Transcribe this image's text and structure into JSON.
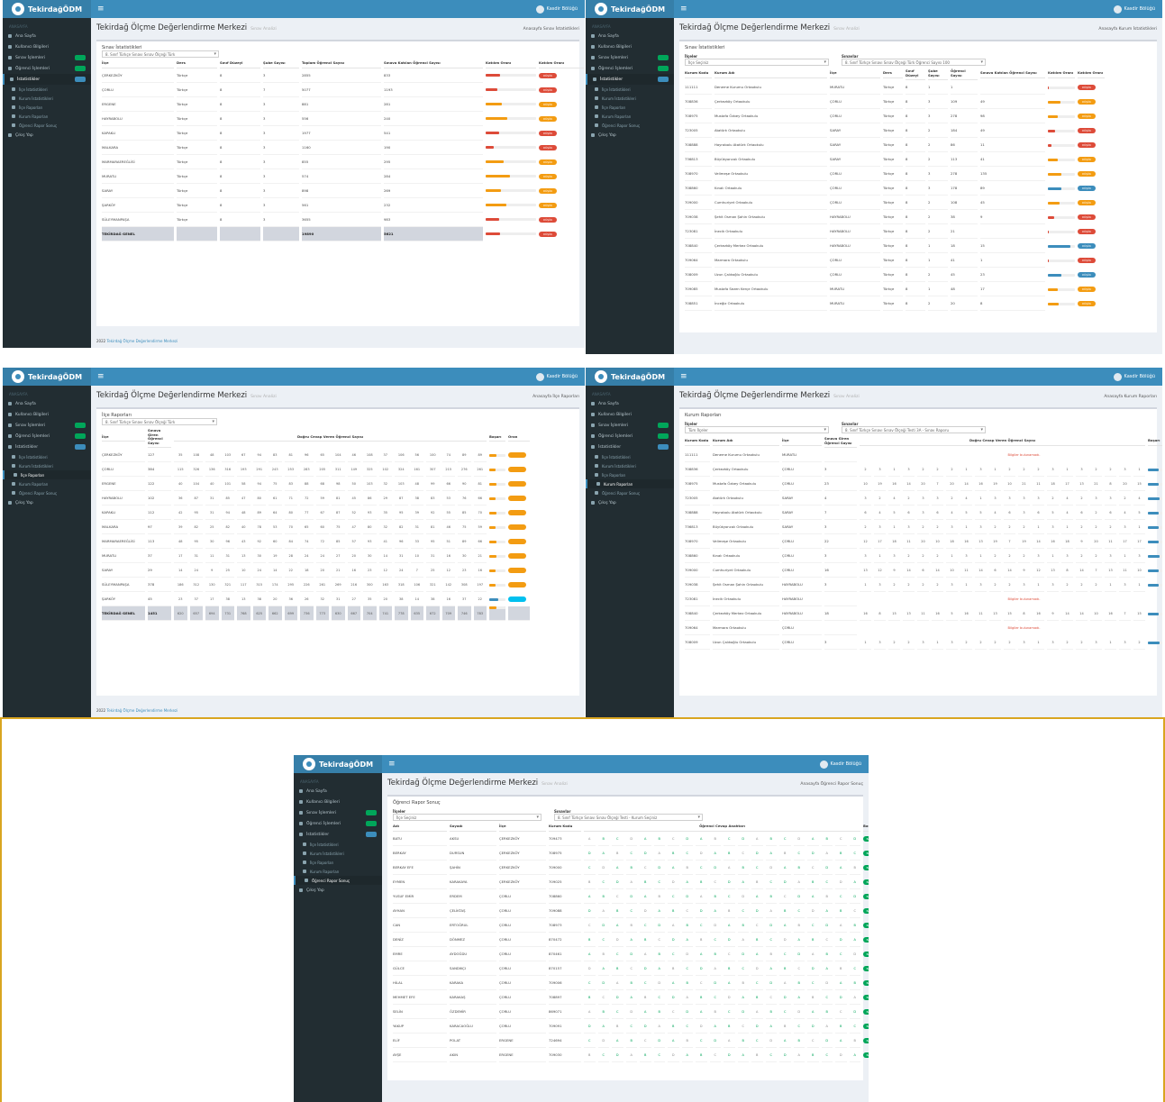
{
  "app": {
    "logo": "TekirdağÖDM",
    "user": "Kasdir Bölüğü",
    "page_title": "Tekirdağ Ölçme Değerlendirme Merkezi",
    "page_subtitle": "Sınav Analizi",
    "footer": "2022",
    "footer_link": "Tekirdağ Ölçme Değerlendirme Merkezi"
  },
  "colors": {
    "brand": "#3c8dbc",
    "sidebar": "#222d32",
    "danger": "#dd4b39",
    "warning": "#f39c12",
    "info": "#00c0ef",
    "success": "#00a65a",
    "primary": "#3c8dbc"
  },
  "sidebar": {
    "header": "ANASAYFA",
    "items": [
      {
        "label": "Ana Sayfa",
        "icon": "home-icon"
      },
      {
        "label": "Kullanıcı Bilgileri",
        "icon": "user-icon"
      },
      {
        "label": "Sınav İşlemleri",
        "icon": "exam-icon"
      },
      {
        "label": "Öğrenci İşlemleri",
        "icon": "student-icon"
      },
      {
        "label": "İstatistikler",
        "icon": "chart-icon"
      },
      {
        "label": "İlçe İstatistikleri",
        "icon": "chart-icon"
      },
      {
        "label": "Kurum İstatistikleri",
        "icon": "chart-icon"
      },
      {
        "label": "İlçe Raporları",
        "icon": "report-icon"
      },
      {
        "label": "Kurum Raporları",
        "icon": "report-icon"
      },
      {
        "label": "Öğrenci Rapor Sonuç",
        "icon": "report-icon"
      },
      {
        "label": "Çıkış Yap",
        "icon": "logout-icon"
      }
    ]
  },
  "screen1": {
    "box_title": "Sınav İstatistikleri",
    "filter": "8. Sınıf Türkçe Sınavı Sınav Ölçeği Türk",
    "crumb": "Anasayfa  Sınav İstatistikleri",
    "headers": [
      "İlçe",
      "Ders",
      "Sınıf Düzeyi",
      "Şube Sayısı",
      "Toplam Öğrenci Sayısı",
      "Sınava Katılan Öğrenci Sayısı",
      "Katılım Oranı",
      "Katılım Oranı"
    ],
    "rows": [
      {
        "ilce": "ÇERKEZKÖY",
        "ders": "Türkçe",
        "sinif": "8",
        "sube": "3",
        "toplam": "2855",
        "katilan": "833",
        "oran": 0.29
      },
      {
        "ilce": "ÇORLU",
        "ders": "Türkçe",
        "sinif": "8",
        "sube": "7",
        "toplam": "5077",
        "katilan": "1193",
        "oran": 0.23
      },
      {
        "ilce": "ERGENE",
        "ders": "Türkçe",
        "sinif": "8",
        "sube": "3",
        "toplam": "881",
        "katilan": "281",
        "oran": 0.32
      },
      {
        "ilce": "HAYRABOLU",
        "ders": "Türkçe",
        "sinif": "8",
        "sube": "3",
        "toplam": "556",
        "katilan": "240",
        "oran": 0.43
      },
      {
        "ilce": "KAPAKLI",
        "ders": "Türkçe",
        "sinif": "8",
        "sube": "3",
        "toplam": "1977",
        "katilan": "541",
        "oran": 0.27
      },
      {
        "ilce": "MALKARA",
        "ders": "Türkçe",
        "sinif": "8",
        "sube": "3",
        "toplam": "1160",
        "katilan": "190",
        "oran": 0.16
      },
      {
        "ilce": "MARMARAEREĞLİSİ",
        "ders": "Türkçe",
        "sinif": "8",
        "sube": "3",
        "toplam": "855",
        "katilan": "295",
        "oran": 0.35
      },
      {
        "ilce": "MURATLI",
        "ders": "Türkçe",
        "sinif": "8",
        "sube": "3",
        "toplam": "574",
        "katilan": "284",
        "oran": 0.49
      },
      {
        "ilce": "SARAY",
        "ders": "Türkçe",
        "sinif": "8",
        "sube": "3",
        "toplam": "898",
        "katilan": "269",
        "oran": 0.3
      },
      {
        "ilce": "ŞARKÖY",
        "ders": "Türkçe",
        "sinif": "8",
        "sube": "3",
        "toplam": "561",
        "katilan": "232",
        "oran": 0.41
      },
      {
        "ilce": "SÜLEYMANPAŞA",
        "ders": "Türkçe",
        "sinif": "8",
        "sube": "3",
        "toplam": "3655",
        "katilan": "983",
        "oran": 0.27
      }
    ],
    "total": {
      "ilce": "TEKİRDAĞ GENEL",
      "toplam": "19890",
      "katilan": "5621",
      "oran": 0.28
    },
    "pill": "DÜŞÜK"
  },
  "screen2": {
    "box_title": "Sınav İstatistikleri",
    "label1": "İlçeler",
    "label2": "Sınavlar",
    "filter1": "İlçe Seçiniz",
    "filter2": "8. Sınıf Türkçe Sınavı Sınav Ölçeği Türk  Öğrenci Sayısı 100",
    "crumb": "Anasayfa  Kurum İstatistikleri",
    "headers": [
      "Kurum Kodu",
      "Kurum Adı",
      "İlçe",
      "Ders",
      "Sınıf Düzeyi",
      "Şube Sayısı",
      "Öğrenci Sayısı",
      "Sınava Katılan Öğrenci Sayısı",
      "Katılım Oranı",
      "Katılım Oranı"
    ],
    "rows": [
      {
        "kod": "111111",
        "ad": "Deneme Kurumu Ortaokulu",
        "ilce": "MURATLI",
        "sube": "1",
        "ogr": "1",
        "kat": "",
        "oran": 0.0
      },
      {
        "kod": "708836",
        "ad": "Çerkezköy Ortaokulu",
        "ilce": "ÇORLU",
        "sube": "3",
        "ogr": "109",
        "kat": "49",
        "oran": 0.45
      },
      {
        "kod": "708975",
        "ad": "Mustafa Özbey Ortaokulu",
        "ilce": "ÇORLU",
        "sube": "3",
        "ogr": "278",
        "kat": "98",
        "oran": 0.35
      },
      {
        "kod": "723005",
        "ad": "Atatürk Ortaokulu",
        "ilce": "SARAY",
        "sube": "2",
        "ogr": "184",
        "kat": "49",
        "oran": 0.27
      },
      {
        "kod": "708888",
        "ad": "Hayrabolu Atatürk Ortaokulu",
        "ilce": "SARAY",
        "sube": "2",
        "ogr": "86",
        "kat": "11",
        "oran": 0.13
      },
      {
        "kod": "736813",
        "ad": "Büyükyoncalı Ortaokulu",
        "ilce": "SARAY",
        "sube": "2",
        "ogr": "113",
        "kat": "41",
        "oran": 0.36
      },
      {
        "kod": "708970",
        "ad": "Velimeşe Ortaokulu",
        "ilce": "ÇORLU",
        "sube": "3",
        "ogr": "278",
        "kat": "135",
        "oran": 0.49
      },
      {
        "kod": "708860",
        "ad": "Kınalı Ortaokulu",
        "ilce": "ÇORLU",
        "sube": "3",
        "ogr": "178",
        "kat": "89",
        "oran": 0.5
      },
      {
        "kod": "709000",
        "ad": "Cumhuriyet Ortaokulu",
        "ilce": "ÇORLU",
        "sube": "2",
        "ogr": "108",
        "kat": "45",
        "oran": 0.42
      },
      {
        "kod": "709038",
        "ad": "Şehit Osman Şahin Ortaokulu",
        "ilce": "HAYRABOLU",
        "sube": "2",
        "ogr": "38",
        "kat": "9",
        "oran": 0.24
      },
      {
        "kod": "723081",
        "ad": "İnecik Ortaokulu",
        "ilce": "HAYRABOLU",
        "sube": "2",
        "ogr": "21",
        "kat": "",
        "oran": 0.0
      },
      {
        "kod": "708840",
        "ad": "Çerkezköy Merkez Ortaokulu",
        "ilce": "HAYRABOLU",
        "sube": "1",
        "ogr": "18",
        "kat": "15",
        "oran": 0.83
      },
      {
        "kod": "709064",
        "ad": "Marmara Ortaokulu",
        "ilce": "ÇORLU",
        "sube": "1",
        "ogr": "41",
        "kat": "1",
        "oran": 0.02
      },
      {
        "kod": "708009",
        "ad": "Uzun Çalıkoğlu Ortaokulu",
        "ilce": "ÇORLU",
        "sube": "2",
        "ogr": "45",
        "kat": "23",
        "oran": 0.51
      },
      {
        "kod": "709085",
        "ad": "Mustafa Sezen Kerçe Ortaokulu",
        "ilce": "MURATLI",
        "sube": "1",
        "ogr": "48",
        "kat": "17",
        "oran": 0.35
      },
      {
        "kod": "708851",
        "ad": "İnceğiz Ortaokulu",
        "ilce": "MURATLI",
        "sube": "2",
        "ogr": "20",
        "kat": "8",
        "oran": 0.4
      }
    ],
    "pill": "DÜŞÜK"
  },
  "screen3": {
    "box_title": "İlçe Raporları",
    "filter": "8. Sınıf Türkçe Sınavı Sınav Ölçeği Türk",
    "crumb": "Anasayfa  İlçe Raporları",
    "group_header": "Doğru Cevap Veren Öğrenci Sayısı",
    "headers_a": [
      "İlçe",
      "Sınava Giren Öğrenci Sayısı"
    ],
    "headers_b": [
      "Başarı",
      "Oran"
    ],
    "q_prefix": "Soru",
    "rows": [
      {
        "ilce": "ÇERKEZKÖY",
        "n": "127",
        "s": 0.42
      },
      {
        "ilce": "ÇORLU",
        "n": "384",
        "s": 0.39
      },
      {
        "ilce": "ERGENE",
        "n": "122",
        "s": 0.45
      },
      {
        "ilce": "HAYRABOLU",
        "n": "102",
        "s": 0.41
      },
      {
        "ilce": "KAPAKLI",
        "n": "112",
        "s": 0.44
      },
      {
        "ilce": "MALKARA",
        "n": "97",
        "s": 0.4
      },
      {
        "ilce": "MARMARAEREĞLİSİ",
        "n": "113",
        "s": 0.43
      },
      {
        "ilce": "MURATLI",
        "n": "37",
        "s": 0.46
      },
      {
        "ilce": "SARAY",
        "n": "29",
        "s": 0.38
      },
      {
        "ilce": "SÜLEYMANPAŞA",
        "n": "378",
        "s": 0.41
      },
      {
        "ilce": "ŞARKÖY",
        "n": "45",
        "s": 0.55
      }
    ],
    "total": {
      "ilce": "TEKİRDAĞ GENEL",
      "n": "1451"
    }
  },
  "screen4": {
    "box_title": "Kurum Raporları",
    "label1": "İlçeler",
    "label2": "Sınavlar",
    "filter1": "Tüm İlçeler",
    "filter2": "8. Sınıf Türkçe Sınavı Sınav Ölçeği Testi 3A - Sınav Raporu",
    "crumb": "Anasayfa  Kurum Raporları",
    "group_header": "Doğru Cevap Veren Öğrenci Sayısı",
    "headers": [
      "Kurum Kodu",
      "Kurum Adı",
      "İlçe",
      "Sınava Giren Öğrenci Sayısı"
    ],
    "headers_b": [
      "Başarı",
      "Oran"
    ],
    "warning": "Bilgiler bulunamadı.",
    "rows": [
      {
        "kod": "111111",
        "ad": "Deneme Kurumu Ortaokulu",
        "ilce": "MURATLI",
        "n": "",
        "warn": true
      },
      {
        "kod": "708836",
        "ad": "Çerkezköy Ortaokulu",
        "ilce": "ÇORLU",
        "n": "3",
        "warn": false
      },
      {
        "kod": "708975",
        "ad": "Mustafa Özbey Ortaokulu",
        "ilce": "ÇORLU",
        "n": "23",
        "warn": false
      },
      {
        "kod": "723005",
        "ad": "Atatürk Ortaokulu",
        "ilce": "SARAY",
        "n": "4",
        "warn": false
      },
      {
        "kod": "708888",
        "ad": "Hayrabolu Atatürk Ortaokulu",
        "ilce": "SARAY",
        "n": "7",
        "warn": false
      },
      {
        "kod": "736813",
        "ad": "Büyükyoncalı Ortaokulu",
        "ilce": "SARAY",
        "n": "3",
        "warn": false
      },
      {
        "kod": "708970",
        "ad": "Velimeşe Ortaokulu",
        "ilce": "ÇORLU",
        "n": "22",
        "warn": false
      },
      {
        "kod": "708860",
        "ad": "Kınalı Ortaokulu",
        "ilce": "ÇORLU",
        "n": "3",
        "warn": false
      },
      {
        "kod": "709000",
        "ad": "Cumhuriyet Ortaokulu",
        "ilce": "ÇORLU",
        "n": "16",
        "warn": false
      },
      {
        "kod": "709038",
        "ad": "Şehit Osman Şahin Ortaokulu",
        "ilce": "HAYRABOLU",
        "n": "3",
        "warn": false
      },
      {
        "kod": "723081",
        "ad": "İnecik Ortaokulu",
        "ilce": "HAYRABOLU",
        "n": "",
        "warn": true
      },
      {
        "kod": "708840",
        "ad": "Çerkezköy Merkez Ortaokulu",
        "ilce": "HAYRABOLU",
        "n": "18",
        "warn": false
      },
      {
        "kod": "709064",
        "ad": "Marmara Ortaokulu",
        "ilce": "ÇORLU",
        "n": "",
        "warn": true
      },
      {
        "kod": "708009",
        "ad": "Uzun Çalıkoğlu Ortaokulu",
        "ilce": "ÇORLU",
        "n": "3",
        "warn": false
      }
    ]
  },
  "screen5": {
    "box_title": "Öğrenci Rapor Sonuç",
    "label1": "İlçeler",
    "label2": "Sınavlar",
    "filter1": "İlçe Seçiniz",
    "filter2": "8. Sınıf Türkçe Sınavı Sınav Ölçeği Testi - Kurum Seçiniz",
    "crumb": "Anasayfa  Öğrenci Rapor Sonuç",
    "group_header": "Öğrenci Cevap Anahtarı",
    "headers": [
      "Adı",
      "Soyadı",
      "İlçe",
      "Kurum Kodu"
    ],
    "headers_b": [
      "Başarı Oranı"
    ],
    "pill": "BAŞARILI",
    "rows": [
      {
        "ad": "BATU",
        "soyad": "AKSU",
        "ilce": "ÇERKEZKÖY",
        "kod": "709473"
      },
      {
        "ad": "BERKAY",
        "soyad": "DURSUN",
        "ilce": "ÇERKEZKÖY",
        "kod": "708975"
      },
      {
        "ad": "BERKAY EFE",
        "soyad": "ŞAHİN",
        "ilce": "ÇERKEZKÖY",
        "kod": "709000"
      },
      {
        "ad": "EYMEN",
        "soyad": "KARAKAYA",
        "ilce": "ÇERKEZKÖY",
        "kod": "709025"
      },
      {
        "ad": "YUSUF EMİR",
        "soyad": "ERDEM",
        "ilce": "ÇORLU",
        "kod": "708860"
      },
      {
        "ad": "AYHAN",
        "soyad": "ÇELİKTAŞ",
        "ilce": "ÇORLU",
        "kod": "709088"
      },
      {
        "ad": "CAN",
        "soyad": "ERTOĞRUL",
        "ilce": "ÇORLU",
        "kod": "708973"
      },
      {
        "ad": "DENİZ",
        "soyad": "DÖNMEZ",
        "ilce": "ÇORLU",
        "kod": "870472"
      },
      {
        "ad": "EMRE",
        "soyad": "AYDOĞDU",
        "ilce": "ÇORLU",
        "kod": "870461"
      },
      {
        "ad": "GÜLCE",
        "soyad": "SANDIKÇI",
        "ilce": "ÇORLU",
        "kod": "870157"
      },
      {
        "ad": "HİLAL",
        "soyad": "KARAKA",
        "ilce": "ÇORLU",
        "kod": "709006"
      },
      {
        "ad": "MEHMET EFE",
        "soyad": "KARAKAŞ",
        "ilce": "ÇORLU",
        "kod": "708897"
      },
      {
        "ad": "SELİN",
        "soyad": "ÖZDEMİR",
        "ilce": "ÇORLU",
        "kod": "869071"
      },
      {
        "ad": "YAKUP",
        "soyad": "KARACAOĞLU",
        "ilce": "ÇORLU",
        "kod": "709091"
      },
      {
        "ad": "ELİF",
        "soyad": "POLAT",
        "ilce": "ERGENE",
        "kod": "724694"
      },
      {
        "ad": "AYŞE",
        "soyad": "AKIN",
        "ilce": "ERGENE",
        "kod": "709030"
      }
    ]
  }
}
